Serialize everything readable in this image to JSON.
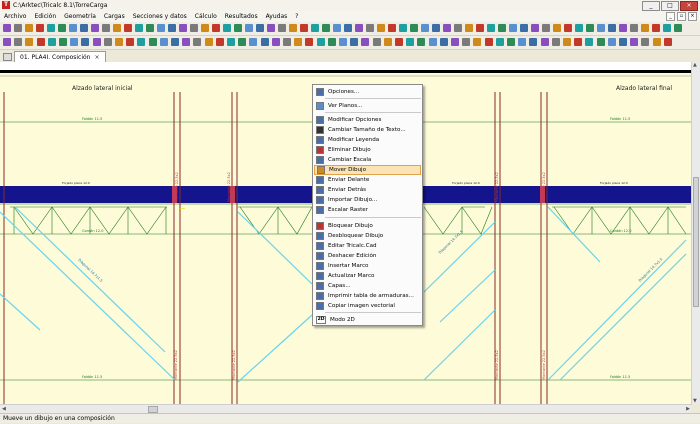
{
  "window": {
    "title": "C:\\Arktec\\Tricalc 8.1\\TorreCarga"
  },
  "menubar": [
    "Archivo",
    "Edición",
    "Geometría",
    "Cargas",
    "Secciones y datos",
    "Cálculo",
    "Resultados",
    "Ayudas",
    "?"
  ],
  "tab": {
    "label": "01. PLA4I. Composición"
  },
  "drawing": {
    "left_title": "Alzado lateral inicial",
    "right_title": "Alzado lateral final",
    "diagonal_label": "Diagonal 14.7x1.5",
    "montante_label": "Montante 22.5x2",
    "cordon_label": "Cordón 12.0",
    "top_label": "Faldón 11.5",
    "beam_label": "Forjado placa 12.0"
  },
  "context_menu": {
    "items": [
      {
        "label": "Opciones...",
        "icon": "options-icon"
      },
      {
        "label": "Ver Planos...",
        "icon": "view-plans-icon"
      },
      {
        "label": "Modificar Opciones",
        "icon": "modify-options-icon"
      },
      {
        "label": "Cambiar Tamaño de Texto...",
        "icon": "text-size-icon"
      },
      {
        "label": "Modificar Leyenda",
        "icon": "legend-icon"
      },
      {
        "label": "Eliminar Dibujo",
        "icon": "delete-drawing-icon"
      },
      {
        "label": "Cambiar Escala",
        "icon": "scale-icon"
      },
      {
        "label": "Mover Dibujo",
        "icon": "move-drawing-icon"
      },
      {
        "label": "Enviar Delante",
        "icon": "bring-front-icon"
      },
      {
        "label": "Enviar Detrás",
        "icon": "send-back-icon"
      },
      {
        "label": "Importar Dibujo...",
        "icon": "import-drawing-icon"
      },
      {
        "label": "Escalar Raster",
        "icon": "raster-scale-icon"
      },
      {
        "label": "Bloquear Dibujo",
        "icon": "lock-drawing-icon"
      },
      {
        "label": "Desbloquear Dibujo",
        "icon": "unlock-drawing-icon"
      },
      {
        "label": "Editar Tricalc.Cad",
        "icon": "edit-cad-icon"
      },
      {
        "label": "Deshacer Edición",
        "icon": "undo-edit-icon"
      },
      {
        "label": "Insertar Marco",
        "icon": "insert-frame-icon"
      },
      {
        "label": "Actualizar Marco",
        "icon": "update-frame-icon"
      },
      {
        "label": "Capas...",
        "icon": "layers-icon"
      },
      {
        "label": "Imprimir tabla de armaduras...",
        "icon": "print-table-icon"
      },
      {
        "label": "Copiar imagen vectorial",
        "icon": "copy-vector-icon"
      },
      {
        "label": "Modo 2D",
        "icon": "mode-2d-icon"
      }
    ],
    "highlighted": "Mover Dibujo",
    "mode_icon_text": "2D"
  },
  "statusbar": {
    "text": "Mueve un dibujo en una composición"
  },
  "colors": {
    "beam": "#14148c",
    "canvas": "#fdfbd8",
    "structure": "#1e7a1e",
    "diagonal": "#67d4ec",
    "column": "#b23a3a"
  }
}
